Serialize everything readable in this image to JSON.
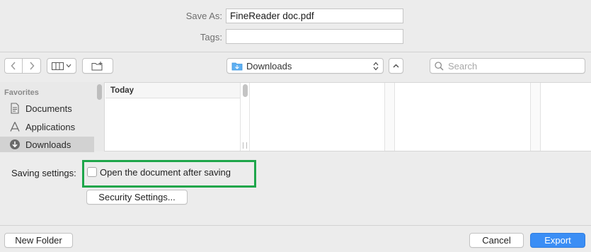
{
  "header": {
    "save_as_label": "Save As:",
    "save_as_value": "FineReader doc.pdf",
    "tags_label": "Tags:",
    "tags_value": ""
  },
  "toolbar": {
    "location": "Downloads",
    "search_placeholder": "Search"
  },
  "sidebar": {
    "section": "Favorites",
    "items": [
      {
        "label": "Documents",
        "icon": "document-icon"
      },
      {
        "label": "Applications",
        "icon": "applications-icon"
      },
      {
        "label": "Downloads",
        "icon": "downloads-icon",
        "selected": true
      }
    ]
  },
  "browser": {
    "column_header": "Today"
  },
  "settings": {
    "label": "Saving settings:",
    "checkbox_label": "Open the document after saving",
    "checkbox_checked": false,
    "security_button": "Security Settings..."
  },
  "footer": {
    "new_folder": "New Folder",
    "cancel": "Cancel",
    "export": "Export"
  },
  "colors": {
    "accent": "#3b8ef5",
    "highlight": "#1ea64a"
  }
}
